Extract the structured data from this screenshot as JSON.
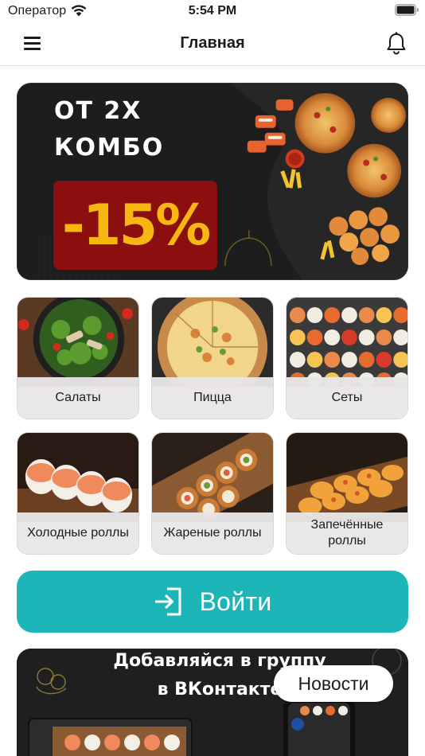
{
  "status_bar": {
    "carrier": "Оператор",
    "time": "5:54 PM"
  },
  "nav": {
    "title": "Главная",
    "menu_icon": "hamburger-icon",
    "notification_icon": "bell-icon"
  },
  "promo": {
    "title": "ОТ 2Х\nКОМБО",
    "discount": "-15%",
    "colors": {
      "background": "#1b1b1b",
      "badge": "#8b0f0f",
      "discount_text": "#f7b713"
    }
  },
  "categories": [
    {
      "label": "Салаты"
    },
    {
      "label": "Пицца"
    },
    {
      "label": "Сеты"
    },
    {
      "label": "Холодные роллы"
    },
    {
      "label": "Жареные роллы"
    },
    {
      "label": "Запечённые роллы"
    }
  ],
  "login": {
    "label": "Войти",
    "icon": "login-arrow-icon",
    "color": "#1db6b8"
  },
  "vk_banner": {
    "title": "Добавляйся в группу\nв ВКонтакте",
    "news_label": "Новости"
  }
}
